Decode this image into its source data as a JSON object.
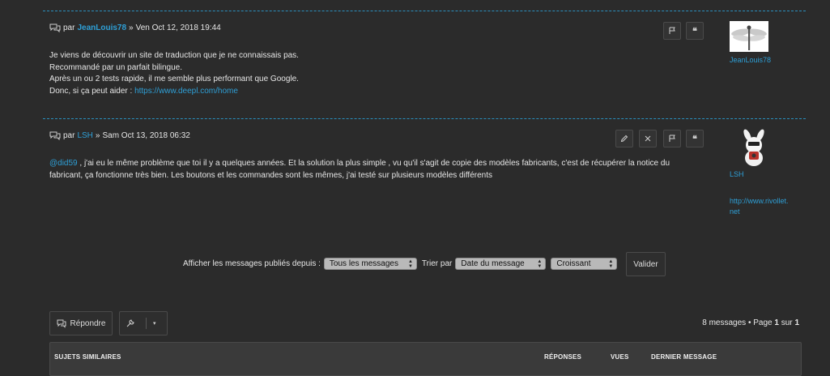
{
  "post1": {
    "by": "par",
    "author": "JeanLouis78",
    "sep": "»",
    "date": "Ven Oct 12, 2018 19:44",
    "lines": [
      "Je viens de découvrir un site de traduction que je ne connaissais pas.",
      "Recommandé par un parfait bilingue.",
      "Après un ou 2 tests rapide, il me semble plus performant que Google."
    ],
    "last_line_prefix": "Donc, si ça peut aider : ",
    "link": "https://www.deepl.com/home",
    "profile_name": "JeanLouis78"
  },
  "post2": {
    "by": "par",
    "author": "LSH",
    "sep": "»",
    "date": "Sam Oct 13, 2018 06:32",
    "mention": "@did59",
    "line1_rest": " , j'ai eu le même problème que toi il y a quelques années. Et la solution la plus simple , vu qu'il s'agit de copie des modèles fabricants, c'est de récupérer la notice du",
    "line2": "fabricant, ça fonctionne très bien. Les boutons et les commandes sont les mêmes, j'ai testé sur plusieurs modèles différents",
    "profile_name": "LSH",
    "website_line1": "http://www.rivollet.",
    "website_line2": "net"
  },
  "sort": {
    "label_display": "Afficher les messages publiés depuis :",
    "display_value": "Tous les messages",
    "label_sort": "Trier par",
    "sort_value": "Date du message",
    "order_value": "Croissant",
    "submit": "Valider"
  },
  "actions": {
    "reply": "Répondre"
  },
  "pagination": {
    "count": "8 messages",
    "bullet": "•",
    "page_word": "Page",
    "current": "1",
    "of": "sur",
    "total": "1"
  },
  "similar": {
    "col_topics": "SUJETS SIMILAIRES",
    "col_replies": "RÉPONSES",
    "col_views": "VUES",
    "col_last": "DERNIER MESSAGE"
  }
}
